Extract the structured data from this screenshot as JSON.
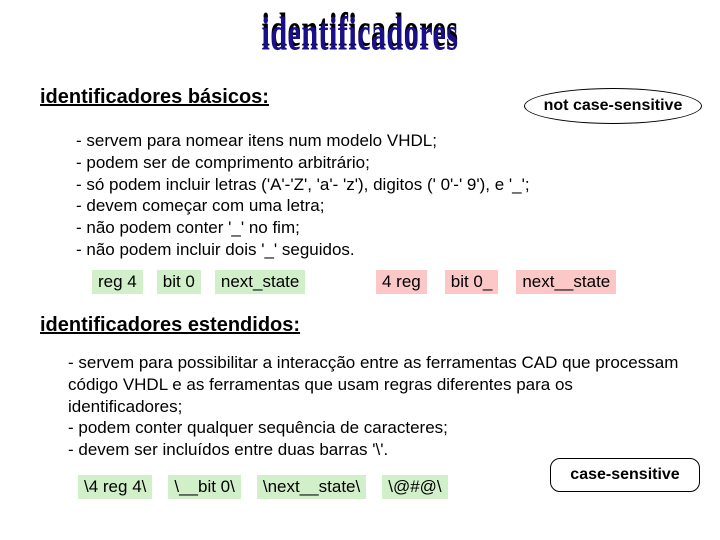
{
  "title": "identificadores",
  "section1": {
    "heading": "identificadores básicos:",
    "badge": "not case-sensitive",
    "bullets": {
      "b1": "- servem para nomear itens num modelo VHDL;",
      "b2": "- podem ser de comprimento arbitrário;",
      "b3": "- só podem incluir letras ('A'-'Z', 'a'- 'z'), digitos (' 0'-' 9'), e '_';",
      "b4": "- devem começar com uma letra;",
      "b5": "- não podem conter '_' no fim;",
      "b6": "- não podem incluir dois '_' seguidos."
    },
    "valid": {
      "e1": "reg 4",
      "e2": "bit 0",
      "e3": "next_state"
    },
    "invalid": {
      "e1": "4 reg",
      "e2": "bit 0_",
      "e3": "next__state"
    }
  },
  "section2": {
    "heading": "identificadores estendidos:",
    "badge": "case-sensitive",
    "bullets": {
      "b1": "- servem para possibilitar a interacção entre as ferramentas CAD que processam código VHDL e as ferramentas que usam regras diferentes para os identificadores;",
      "b2": "- podem conter qualquer sequência de caracteres;",
      "b3": "- devem ser incluídos entre duas barras '\\'."
    },
    "examples": {
      "e1": "\\4 reg 4\\",
      "e2": "\\__bit 0\\",
      "e3": "\\next__state\\",
      "e4": "\\@#@\\"
    }
  }
}
